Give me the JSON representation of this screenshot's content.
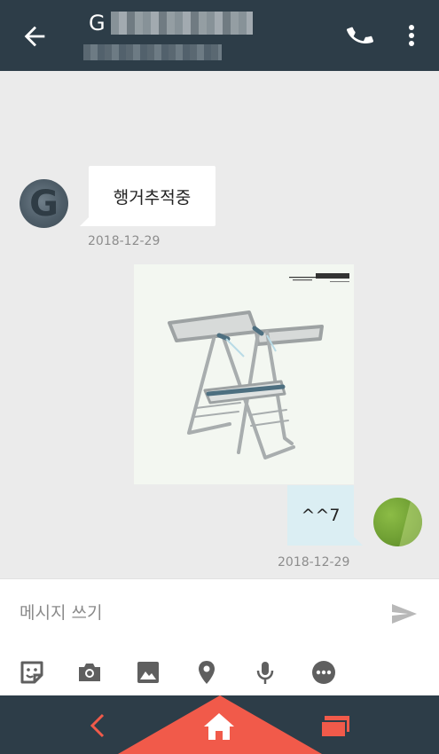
{
  "header": {
    "title_initial": "G",
    "back_icon": "arrow-left-icon",
    "call_icon": "phone-icon",
    "menu_icon": "more-vert-icon"
  },
  "messages": [
    {
      "direction": "incoming",
      "type": "text",
      "text": "행거추적중",
      "date": "2018-12-29",
      "avatar_letter": "G"
    },
    {
      "direction": "outgoing",
      "type": "image",
      "image_desc": "drying-rack-product-image"
    },
    {
      "direction": "outgoing",
      "type": "text",
      "text": "^^7",
      "date": "2018-12-29"
    }
  ],
  "composer": {
    "placeholder": "메시지 쓰기",
    "send_icon": "send-icon",
    "tools": [
      "sticker-icon",
      "camera-icon",
      "image-icon",
      "location-icon",
      "microphone-icon",
      "more-horiz-icon"
    ]
  },
  "navigation": {
    "items": [
      "back-nav-icon",
      "home-icon",
      "recents-icon"
    ]
  },
  "colors": {
    "appbar": "#2d3d48",
    "chat_bg": "#ebebeb",
    "outgoing_bubble": "#dbeef3",
    "incoming_bubble": "#ffffff",
    "accent": "#f15a4a",
    "icon_gray": "#5f5f5f"
  }
}
